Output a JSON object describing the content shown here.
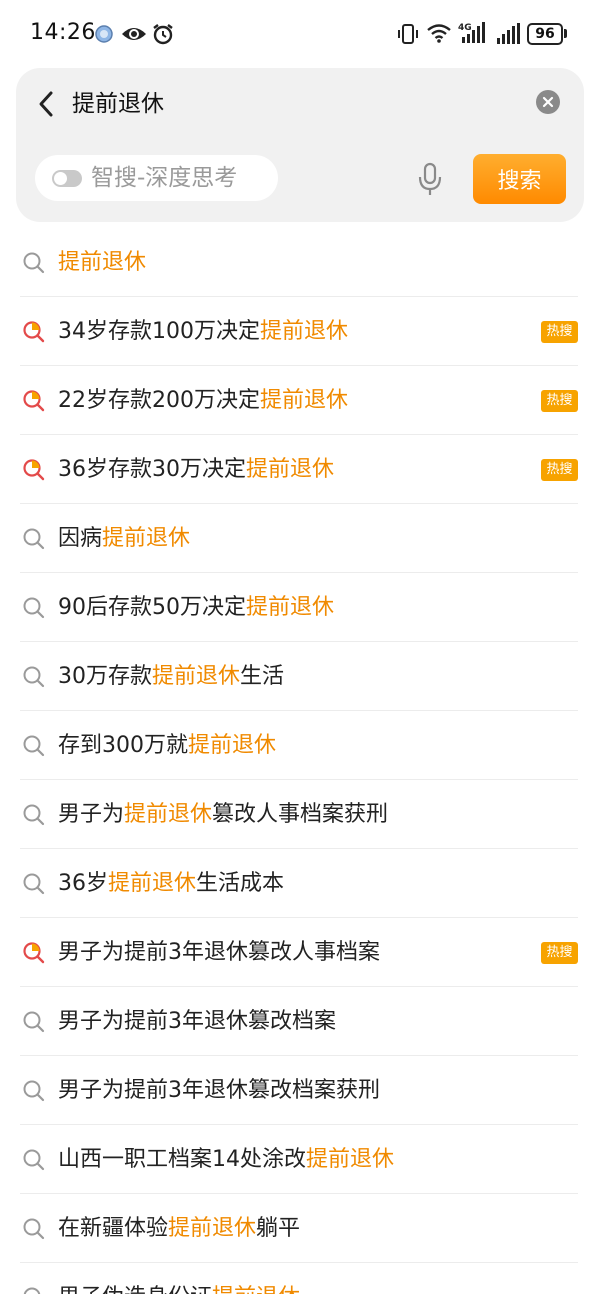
{
  "status_bar": {
    "time": "14:26",
    "icons": [
      "location-dot-icon",
      "eye-icon",
      "alarm-icon",
      "vibrate-icon",
      "wifi-icon",
      "4g-signal-icon",
      "signal-icon",
      "battery-icon"
    ],
    "network": "4G",
    "battery": "96"
  },
  "search": {
    "query": "提前退休",
    "deep_think_label": "智搜-深度思考",
    "deep_think_enabled": false,
    "button_label": "搜索"
  },
  "colors": {
    "accent": "#f08a00",
    "button": "#ff9a14",
    "hot_badge": "#f7a300",
    "hot_icon": "#e34a4a"
  },
  "hot_badge_label": "热搜",
  "suggestions": [
    {
      "text": [
        "",
        "提前退休",
        ""
      ],
      "hot": false
    },
    {
      "text": [
        "34岁存款100万决定",
        "提前退休",
        ""
      ],
      "hot": true
    },
    {
      "text": [
        "22岁存款200万决定",
        "提前退休",
        ""
      ],
      "hot": true
    },
    {
      "text": [
        "36岁存款30万决定",
        "提前退休",
        ""
      ],
      "hot": true
    },
    {
      "text": [
        "因病",
        "提前退休",
        ""
      ],
      "hot": false
    },
    {
      "text": [
        "90后存款50万决定",
        "提前退休",
        ""
      ],
      "hot": false
    },
    {
      "text": [
        "30万存款",
        "提前退休",
        "生活"
      ],
      "hot": false
    },
    {
      "text": [
        "存到300万就",
        "提前退休",
        ""
      ],
      "hot": false
    },
    {
      "text": [
        "男子为",
        "提前退休",
        "篡改人事档案获刑"
      ],
      "hot": false
    },
    {
      "text": [
        "36岁",
        "提前退休",
        "生活成本"
      ],
      "hot": false
    },
    {
      "text": [
        "男子为提前3年退休篡改人事档案",
        "",
        ""
      ],
      "hot": true
    },
    {
      "text": [
        "男子为提前3年退休篡改档案",
        "",
        ""
      ],
      "hot": false
    },
    {
      "text": [
        "男子为提前3年退休篡改档案获刑",
        "",
        ""
      ],
      "hot": false
    },
    {
      "text": [
        "山西一职工档案14处涂改",
        "提前退休",
        ""
      ],
      "hot": false
    },
    {
      "text": [
        "在新疆体验",
        "提前退休",
        "躺平"
      ],
      "hot": false
    },
    {
      "text": [
        "男子伪造身份证",
        "提前退休",
        ""
      ],
      "hot": false
    }
  ]
}
